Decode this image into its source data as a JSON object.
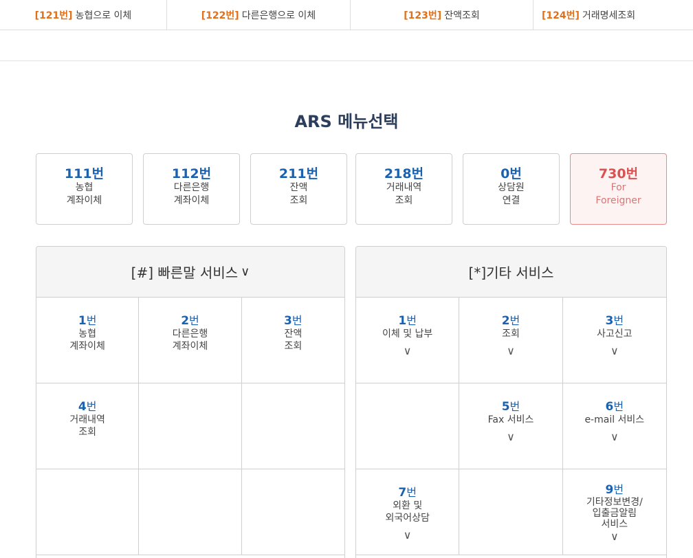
{
  "top_tabs": [
    {
      "code": "[121번]",
      "label": "농협으로 이체"
    },
    {
      "code": "[122번]",
      "label": "다른은행으로 이체"
    },
    {
      "code": "[123번]",
      "label": "잔액조회"
    },
    {
      "code": "[124번]",
      "label": "거래명세조회"
    }
  ],
  "title": "ARS 메뉴선택",
  "menu_buttons": [
    {
      "number": "111번",
      "line1": "농협",
      "line2": "계좌이체"
    },
    {
      "number": "112번",
      "line1": "다른은행",
      "line2": "계좌이체"
    },
    {
      "number": "211번",
      "line1": "잔액",
      "line2": "조회"
    },
    {
      "number": "218번",
      "line1": "거래내역",
      "line2": "조회"
    },
    {
      "number": "0번",
      "line1": "상담원",
      "line2": "연결"
    },
    {
      "number": "730번",
      "line1": "For",
      "line2": "Foreigner"
    }
  ],
  "quick_service": {
    "title": "[#] 빠른말 서비스",
    "chevron": "∨",
    "cells": [
      {
        "num": "1",
        "unit": "번",
        "line1": "농협",
        "line2": "계좌이체"
      },
      {
        "num": "2",
        "unit": "번",
        "line1": "다른은행",
        "line2": "계좌이체"
      },
      {
        "num": "3",
        "unit": "번",
        "line1": "잔액",
        "line2": "조회"
      },
      {
        "num": "4",
        "unit": "번",
        "line1": "거래내역",
        "line2": "조회"
      }
    ]
  },
  "other_service": {
    "title": "[*]기타 서비스",
    "cells": [
      {
        "num": "1",
        "unit": "번",
        "line1": "이체 및 납부",
        "chevron": "∨"
      },
      {
        "num": "2",
        "unit": "번",
        "line1": "조회",
        "chevron": "∨"
      },
      {
        "num": "3",
        "unit": "번",
        "line1": "사고신고",
        "chevron": "∨"
      },
      {
        "num": "5",
        "unit": "번",
        "line1": "Fax 서비스",
        "chevron": "∨"
      },
      {
        "num": "6",
        "unit": "번",
        "line1": "e-mail 서비스",
        "chevron": "∨"
      },
      {
        "num": "7",
        "unit": "번",
        "line1": "외환 및",
        "line2": "외국어상담",
        "chevron": "∨"
      },
      {
        "num": "9",
        "unit": "번",
        "line1": "기타정보변경/",
        "line2": "입출금알림",
        "line3": "서비스",
        "chevron": "∨"
      }
    ]
  }
}
